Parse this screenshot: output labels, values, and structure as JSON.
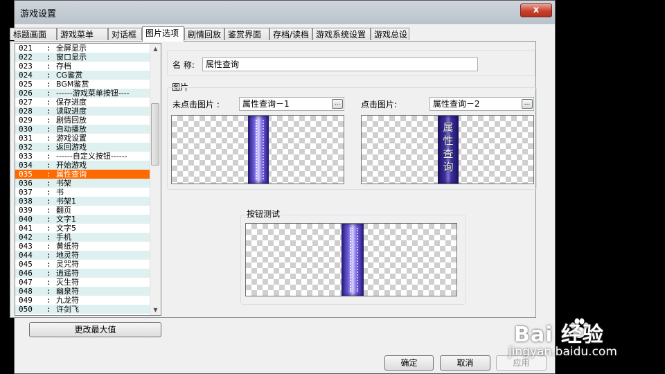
{
  "window": {
    "title": "游戏设置",
    "close_label": "x"
  },
  "tabs": [
    {
      "label": "标题画面"
    },
    {
      "label": "游戏菜单"
    },
    {
      "label": "对话框"
    },
    {
      "label": "图片选项",
      "active": true
    },
    {
      "label": "剧情回放"
    },
    {
      "label": "鉴赏界面"
    },
    {
      "label": "存档/读档"
    },
    {
      "label": "游戏系统设置"
    },
    {
      "label": "游戏总设"
    }
  ],
  "list": {
    "separator": ":",
    "selected_index": 14,
    "items": [
      {
        "num": "021",
        "label": "全屏显示"
      },
      {
        "num": "022",
        "label": "窗口显示"
      },
      {
        "num": "023",
        "label": "存档"
      },
      {
        "num": "024",
        "label": "CG鉴赏"
      },
      {
        "num": "025",
        "label": "BGM鉴赏"
      },
      {
        "num": "026",
        "label": "------游戏菜单按钮----"
      },
      {
        "num": "027",
        "label": "保存进度"
      },
      {
        "num": "028",
        "label": "读取进度"
      },
      {
        "num": "029",
        "label": "剧情回放"
      },
      {
        "num": "030",
        "label": "自动播放"
      },
      {
        "num": "031",
        "label": "游戏设置"
      },
      {
        "num": "032",
        "label": "返回游戏"
      },
      {
        "num": "033",
        "label": "------自定义按钮------"
      },
      {
        "num": "034",
        "label": "开始游戏"
      },
      {
        "num": "035",
        "label": "属性查询"
      },
      {
        "num": "036",
        "label": "书架"
      },
      {
        "num": "037",
        "label": "书"
      },
      {
        "num": "038",
        "label": "书架1"
      },
      {
        "num": "039",
        "label": "翻页"
      },
      {
        "num": "040",
        "label": "文字1"
      },
      {
        "num": "041",
        "label": "文字5"
      },
      {
        "num": "042",
        "label": "手机"
      },
      {
        "num": "043",
        "label": "黄纸符"
      },
      {
        "num": "044",
        "label": "地灵符"
      },
      {
        "num": "045",
        "label": "灵咒符"
      },
      {
        "num": "046",
        "label": "逍遥符"
      },
      {
        "num": "047",
        "label": "灭生符"
      },
      {
        "num": "048",
        "label": "幽泉符"
      },
      {
        "num": "049",
        "label": "九龙符"
      },
      {
        "num": "050",
        "label": "许剑飞"
      }
    ]
  },
  "change_max_button": "更改最大值",
  "name_field": {
    "label": "名  称:",
    "value": "属性查询"
  },
  "picture_group": {
    "title": "图片",
    "normal_label": "未点击图片 :",
    "normal_value": "属性查询－1",
    "clicked_label": "点击图片:",
    "clicked_value": "属性查询－2",
    "browse_label": "..."
  },
  "clicked_image_text": "属性查询",
  "test_group": {
    "title": "按钮测试"
  },
  "footer": {
    "ok": "确定",
    "cancel": "取消",
    "apply": "应用"
  },
  "watermark": {
    "brand": "Bai  经验",
    "url": "jingyan.baidu.com"
  }
}
